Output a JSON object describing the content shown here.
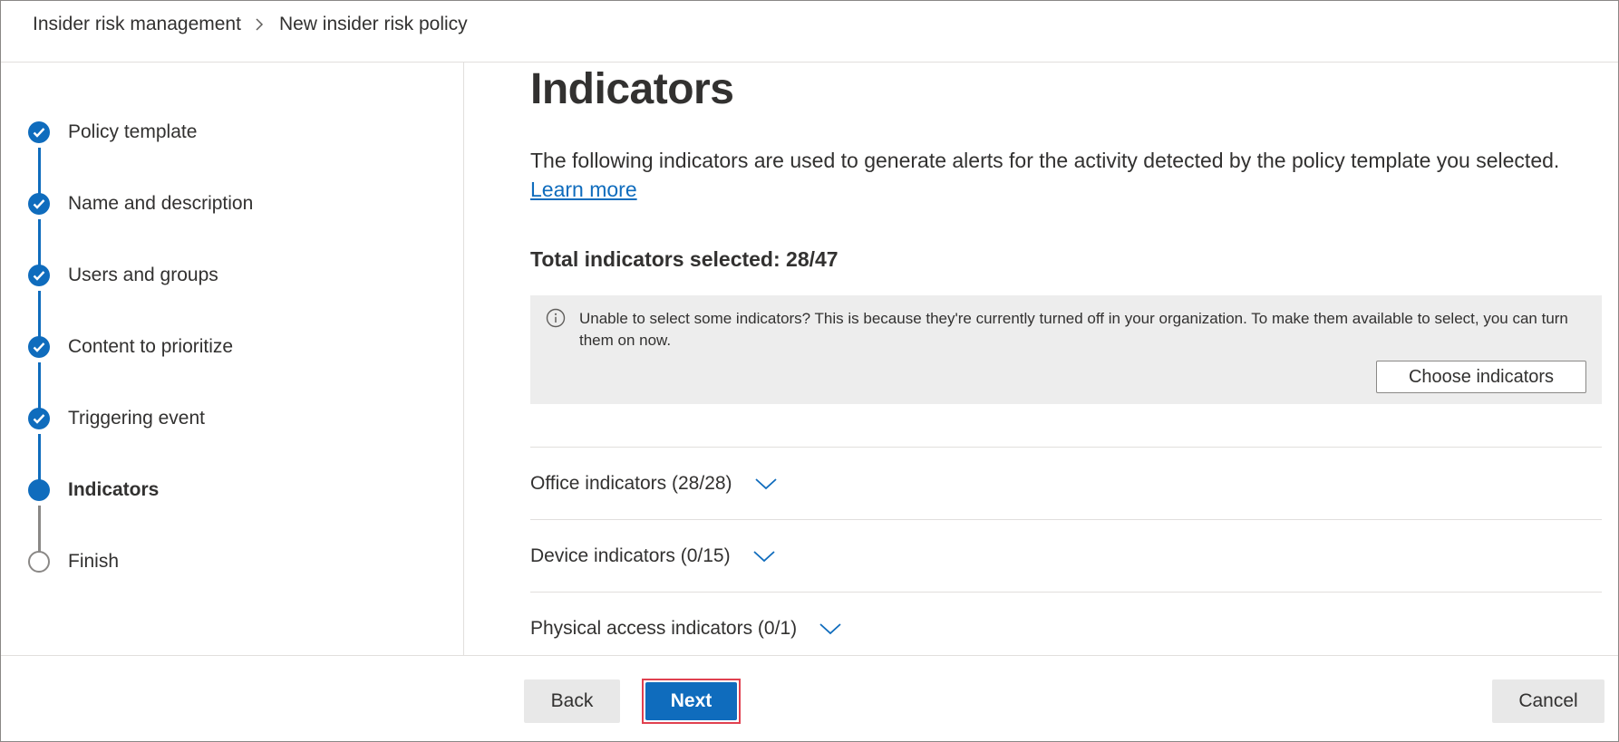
{
  "breadcrumb": {
    "items": [
      "Insider risk management",
      "New insider risk policy"
    ]
  },
  "wizard": {
    "steps": [
      {
        "label": "Policy template",
        "status": "completed"
      },
      {
        "label": "Name and description",
        "status": "completed"
      },
      {
        "label": "Users and groups",
        "status": "completed"
      },
      {
        "label": "Content to prioritize",
        "status": "completed"
      },
      {
        "label": "Triggering event",
        "status": "completed"
      },
      {
        "label": "Indicators",
        "status": "current"
      },
      {
        "label": "Finish",
        "status": "pending"
      }
    ]
  },
  "main": {
    "title": "Indicators",
    "description": "The following indicators are used to generate alerts for the activity detected by the policy template you selected.",
    "learn_more": "Learn more",
    "total_selected": "Total indicators selected: 28/47",
    "info": {
      "icon": "info-icon",
      "text": "Unable to select some indicators? This is because they're currently turned off in your organization. To make them available to select, you can turn them on now.",
      "button": "Choose indicators"
    },
    "sections": [
      {
        "label": "Office indicators (28/28)"
      },
      {
        "label": "Device indicators (0/15)"
      },
      {
        "label": "Physical access indicators (0/1)"
      }
    ]
  },
  "footer": {
    "back": "Back",
    "next": "Next",
    "cancel": "Cancel"
  },
  "colors": {
    "accent": "#0f6cbd",
    "highlight_border": "#e0404f",
    "info_bg": "#ededed"
  }
}
